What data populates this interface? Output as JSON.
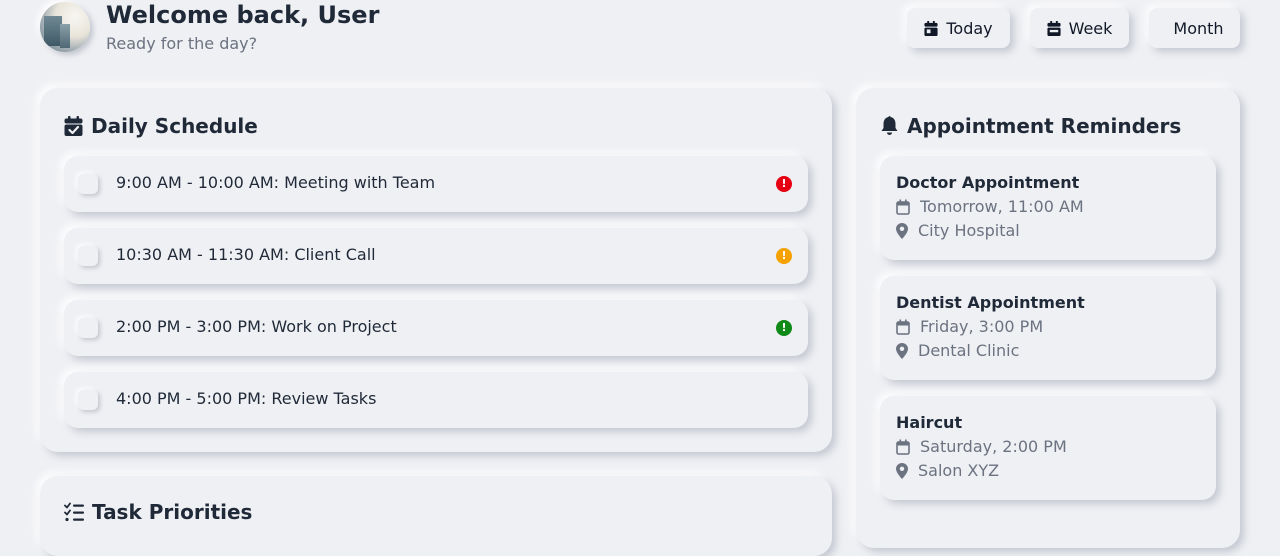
{
  "header": {
    "title": "Welcome back, User",
    "subtitle": "Ready for the day?",
    "views": [
      {
        "label": "Today",
        "icon": "calendar-day-icon"
      },
      {
        "label": "Week",
        "icon": "calendar-week-icon"
      },
      {
        "label": "Month",
        "icon": ""
      }
    ]
  },
  "schedule": {
    "title": "Daily Schedule",
    "icon": "calendar-check-icon",
    "tasks": [
      {
        "text": "9:00 AM - 10:00 AM: Meeting with Team",
        "priority": "high",
        "color": "#e60012"
      },
      {
        "text": "10:30 AM - 11:30 AM: Client Call",
        "priority": "medium",
        "color": "#f5a200"
      },
      {
        "text": "2:00 PM - 3:00 PM: Work on Project",
        "priority": "low",
        "color": "#0f8a16"
      },
      {
        "text": "4:00 PM - 5:00 PM: Review Tasks",
        "priority": "",
        "color": ""
      }
    ]
  },
  "priorities": {
    "title": "Task Priorities",
    "icon": "list-check-icon"
  },
  "reminders": {
    "title": "Appointment Reminders",
    "icon": "bell-icon",
    "items": [
      {
        "title": "Doctor Appointment",
        "when": "Tomorrow, 11:00 AM",
        "where": "City Hospital"
      },
      {
        "title": "Dentist Appointment",
        "when": "Friday, 3:00 PM",
        "where": "Dental Clinic"
      },
      {
        "title": "Haircut",
        "when": "Saturday, 2:00 PM",
        "where": "Salon XYZ"
      }
    ]
  }
}
